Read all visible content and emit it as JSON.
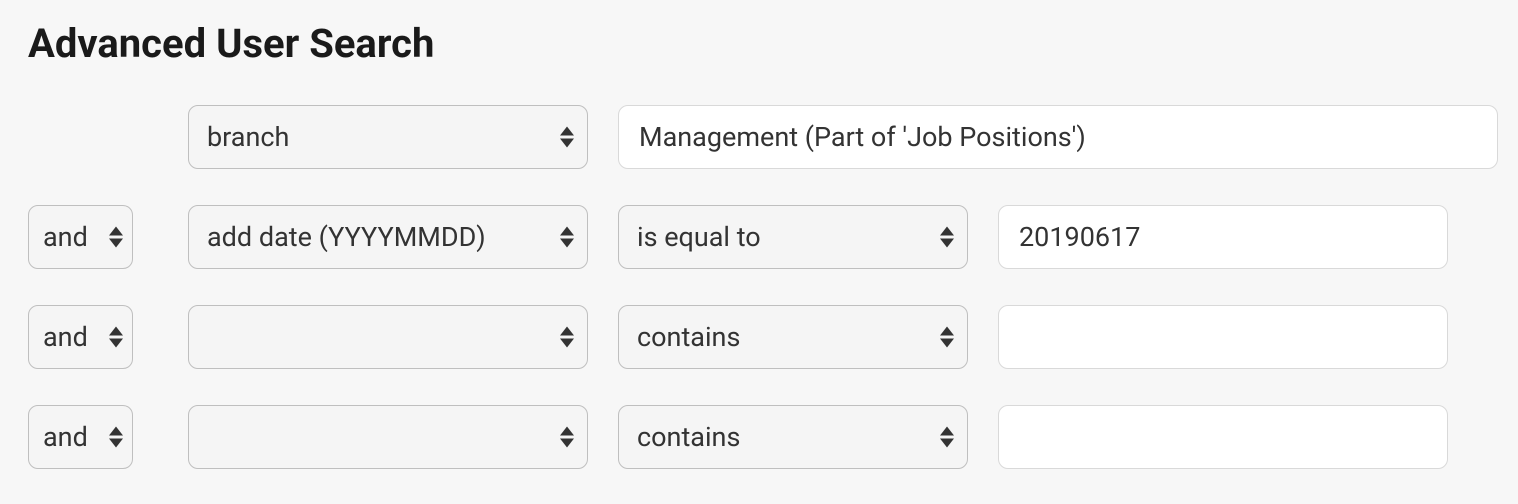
{
  "title": "Advanced User Search",
  "rows": [
    {
      "field": "branch",
      "value": "Management (Part of 'Job Positions')"
    },
    {
      "logic": "and",
      "field": "add date (YYYYMMDD)",
      "operator": "is equal to",
      "value": "20190617"
    },
    {
      "logic": "and",
      "field": "",
      "operator": "contains",
      "value": ""
    },
    {
      "logic": "and",
      "field": "",
      "operator": "contains",
      "value": ""
    }
  ]
}
